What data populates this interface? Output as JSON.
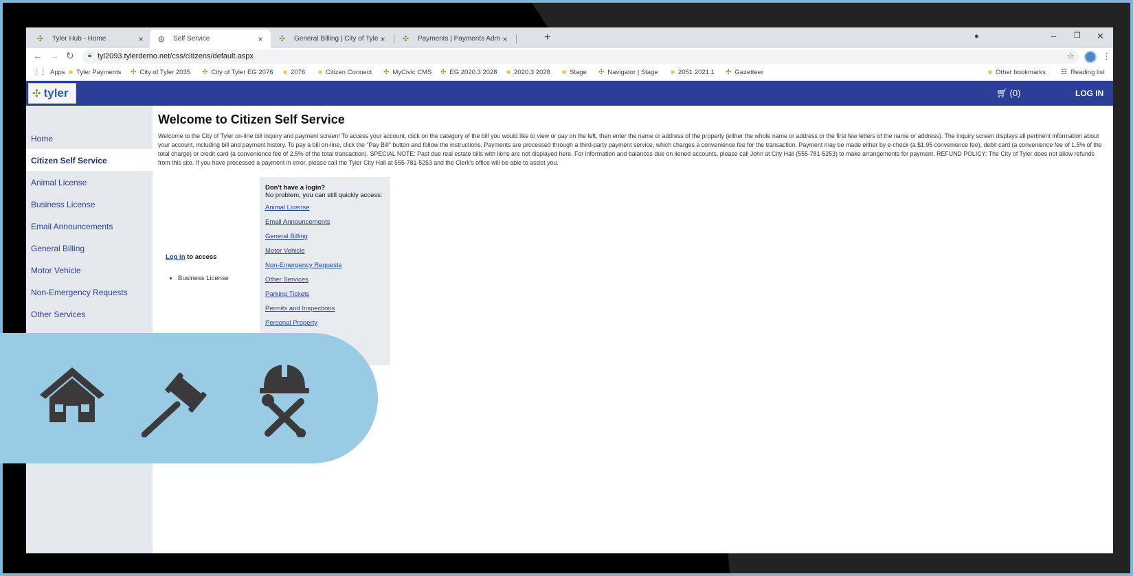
{
  "tabs": [
    {
      "title": "Tyler Hub - Home",
      "active": false
    },
    {
      "title": "Self Service",
      "active": true
    },
    {
      "title": "General Billing | City of Tyler",
      "active": false
    },
    {
      "title": "Payments | Payments Administrat",
      "active": false
    }
  ],
  "tab_close_glyph": "×",
  "new_tab_glyph": "+",
  "window_controls": {
    "minimize": "–",
    "restore": "❐",
    "close": "✕"
  },
  "address": {
    "url": "tyl2093.tylerdemo.net/css/citizens/default.aspx"
  },
  "bookmarks": [
    {
      "label": "Apps",
      "icon": "apps-icon"
    },
    {
      "label": "Tyler Payments",
      "icon": "folder-icon"
    },
    {
      "label": "City of Tyler 2035",
      "icon": "tyler-icon"
    },
    {
      "label": "City of Tyler EG 2076",
      "icon": "tyler-icon"
    },
    {
      "label": "2076",
      "icon": "folder-icon"
    },
    {
      "label": "Citizen Connect",
      "icon": "folder-icon"
    },
    {
      "label": "MyCivic CMS",
      "icon": "tyler-icon"
    },
    {
      "label": "EG 2020.3 2028",
      "icon": "tyler-icon"
    },
    {
      "label": "2020.3 2028",
      "icon": "folder-icon"
    },
    {
      "label": "Stage",
      "icon": "folder-icon"
    },
    {
      "label": "Navigator | Stage",
      "icon": "tyler-icon"
    },
    {
      "label": "2051 2021.1",
      "icon": "folder-icon"
    },
    {
      "label": "Gazetteer",
      "icon": "tyler-icon"
    }
  ],
  "bookmarks_right": {
    "other": "Other bookmarks",
    "reading": "Reading list"
  },
  "header": {
    "logo_text": "tyler",
    "cart_count": "(0)",
    "login_label": "LOG IN"
  },
  "sidebar": {
    "items": [
      {
        "label": "Home",
        "active": false
      },
      {
        "label": "Citizen Self Service",
        "active": true
      },
      {
        "label": "Animal License",
        "active": false
      },
      {
        "label": "Business License",
        "active": false
      },
      {
        "label": "Email Announcements",
        "active": false
      },
      {
        "label": "General Billing",
        "active": false
      },
      {
        "label": "Motor Vehicle",
        "active": false
      },
      {
        "label": "Non-Emergency Requests",
        "active": false
      },
      {
        "label": "Other Services",
        "active": false
      }
    ]
  },
  "main": {
    "title": "Welcome to Citizen Self Service",
    "welcome_text": "Welcome to the City of Tyler on-line bill inquiry and payment screen! To access your account, click on the category of the bill you would like to view or pay on the left, then enter the name or address of the property (either the whole name or address or the first few letters of the name or address). The inquiry screen displays all pertinent information about your account, including bill and payment history. To pay a bill on-line, click the \"Pay Bill\" button and follow the instructions. Payments are processed through a third-party payment service, which charges a convenience fee for the transaction. Payment may be made either by e-check (a $1.95 convenience fee), debit card (a convenience fee of 1.5% of the total charge) or credit card (a convenience fee of 2.5% of the total transaction). SPECIAL NOTE: Past due real estate bills with liens are not displayed here. For information and balances due on liened accounts, please call John at City Hall (555-781-5253) to make arrangements for payment. REFUND POLICY: The City of Tyler does not allow refunds from this site. If you have processed a payment in error, please call the Tyler City Hall at 555-781-5253 and the Clerk's office will be able to assist you.",
    "login_link": "Log in",
    "login_suffix": "to access",
    "login_required": [
      "Business License"
    ],
    "quick_access": {
      "title": "Don't have a login?",
      "subtitle": "No problem, you can still quickly access:",
      "links": [
        "Animal License",
        "Email Announcements",
        "General Billing",
        "Motor Vehicle",
        "Non-Emergency Requests",
        "Other Services",
        "Parking Tickets",
        "Permits and Inspections",
        "Personal Property"
      ]
    }
  },
  "overlay_icons": [
    "house-icon",
    "gavel-icon",
    "hardhat-tools-icon"
  ]
}
